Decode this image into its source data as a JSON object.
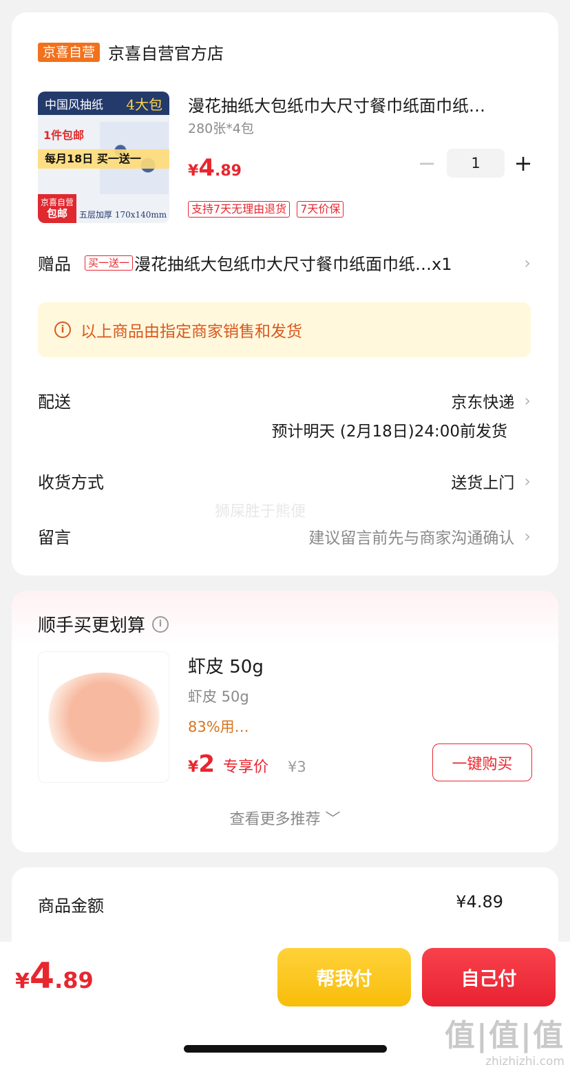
{
  "shop": {
    "badge": "京喜自营",
    "name": "京喜自营官方店"
  },
  "product": {
    "thumb": {
      "top_left": "中国风抽纸",
      "top_right": "4大包",
      "promo": "1件包邮",
      "band": "每月18日 买一送一",
      "red_badge_1": "京喜自营",
      "red_badge_2": "包邮",
      "size_text": "五层加厚 170x140mm"
    },
    "title": "漫花抽纸大包纸巾大尺寸餐巾纸面巾纸…",
    "spec": "280张*4包",
    "price": {
      "currency": "¥",
      "int": "4",
      "dec": ".89"
    },
    "quantity": "1",
    "tags": [
      "支持7天无理由退货",
      "7天价保"
    ]
  },
  "gift": {
    "label": "赠品",
    "tag": "买一送一",
    "text": "漫花抽纸大包纸巾大尺寸餐巾纸面巾纸…x1"
  },
  "notice": {
    "icon": "info-icon",
    "text": "以上商品由指定商家销售和发货"
  },
  "delivery": {
    "label": "配送",
    "value": "京东快递",
    "eta": "预计明天 (2月18日)24:00前发货"
  },
  "receive": {
    "label": "收货方式",
    "value": "送货上门"
  },
  "message": {
    "label": "留言",
    "placeholder": "建议留言前先与商家沟通确认"
  },
  "watermark": "狮屎胜于熊便",
  "recommend": {
    "title": "顺手买更划算",
    "item": {
      "name": "虾皮 50g",
      "spec": "虾皮 50g",
      "rate": "83%用…",
      "price": {
        "currency": "¥",
        "int": "2"
      },
      "price_label": "专享价",
      "old_price": "¥3",
      "buy_label": "一键购买"
    },
    "more_label": "查看更多推荐 ﹀"
  },
  "summary": {
    "label": "商品金额",
    "value": "¥4.89"
  },
  "bottom": {
    "total": {
      "currency": "¥",
      "int": "4",
      "dec": ".89"
    },
    "help_pay": "帮我付",
    "self_pay": "自己付"
  },
  "site_watermark": {
    "big": "值|值|值",
    "small": "zhizhizhi.com"
  },
  "colors": {
    "accent_red": "#e8262e",
    "badge_orange": "#f2711c",
    "help_yellow": "#ffd23a",
    "notice_bg": "#fff8dc"
  }
}
